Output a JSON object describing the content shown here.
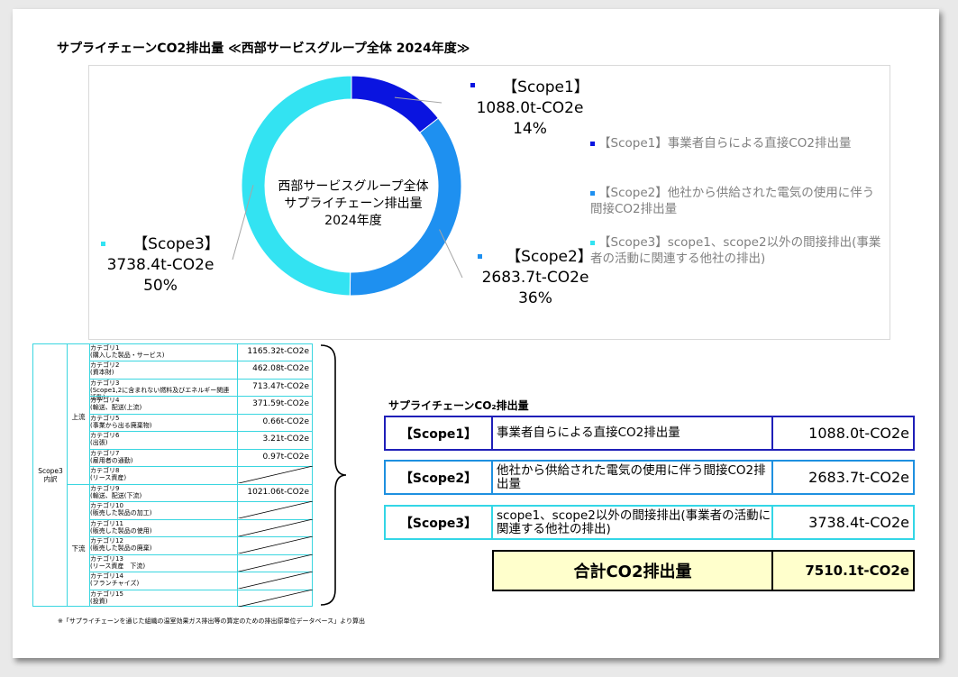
{
  "title": "サプライチェーンCO2排出量 ≪西部サービスグループ全体 2024年度≫",
  "chart_data": {
    "type": "pie",
    "donut": true,
    "center_label": [
      "西部サービスグループ全体",
      "サプライチェーン排出量",
      "2024年度"
    ],
    "slices": [
      {
        "label": "【Scope1】",
        "value": 1088.0,
        "value_text": "1088.0t-CO2e",
        "percent": "14%",
        "color": "#0a14e0"
      },
      {
        "label": "【Scope2】",
        "value": 2683.7,
        "value_text": "2683.7t-CO2e",
        "percent": "36%",
        "color": "#1e90f0"
      },
      {
        "label": "【Scope3】",
        "value": 3738.4,
        "value_text": "3738.4t-CO2e",
        "percent": "50%",
        "color": "#33e3f2"
      }
    ],
    "legend": [
      {
        "text": "【Scope1】事業者自らによる直接CO2排出量",
        "color": "#0a14e0"
      },
      {
        "text": "【Scope2】他社から供給された電気の使用に伴う間接CO2排出量",
        "color": "#1e90f0"
      },
      {
        "text": "【Scope3】scope1、scope2以外の間接排出(事業者の活動に関連する他社の排出)",
        "color": "#33e3f2"
      }
    ],
    "legend_position": "right"
  },
  "scope3_table": {
    "group_label": "Scope3\n内訳",
    "upstream_label": "上流",
    "downstream_label": "下流",
    "rows": [
      {
        "name": "カテゴリ1",
        "desc": "(購入した製品・サービス)",
        "value": "1165.32t-CO2e"
      },
      {
        "name": "カテゴリ2",
        "desc": "(資本財)",
        "value": "462.08t-CO2e"
      },
      {
        "name": "カテゴリ3",
        "desc": "(Scope1,2に含まれない燃料及びエネルギー関連活動)",
        "value": "713.47t-CO2e"
      },
      {
        "name": "カテゴリ4",
        "desc": "(輸送、配送(上流)",
        "value": "371.59t-CO2e"
      },
      {
        "name": "カテゴリ5",
        "desc": "(事業から出る廃棄物)",
        "value": "0.66t-CO2e"
      },
      {
        "name": "カテゴリ6",
        "desc": "(出張)",
        "value": "3.21t-CO2e"
      },
      {
        "name": "カテゴリ7",
        "desc": "(雇用者の通勤)",
        "value": "0.97t-CO2e"
      },
      {
        "name": "カテゴリ8",
        "desc": "(リース資産)",
        "value": ""
      },
      {
        "name": "カテゴリ9",
        "desc": "(輸送、配送(下流)",
        "value": "1021.06t-CO2e"
      },
      {
        "name": "カテゴリ10",
        "desc": "(販売した製品の加工)",
        "value": ""
      },
      {
        "name": "カテゴリ11",
        "desc": "(販売した製品の使用)",
        "value": ""
      },
      {
        "name": "カテゴリ12",
        "desc": "(販売した製品の廃棄)",
        "value": ""
      },
      {
        "name": "カテゴリ13",
        "desc": "(リース資産　下流)",
        "value": ""
      },
      {
        "name": "カテゴリ14",
        "desc": "(フランチャイズ)",
        "value": ""
      },
      {
        "name": "カテゴリ15",
        "desc": "(投資)",
        "value": ""
      }
    ],
    "footnote": "※「サプライチェーンを通じた組織の温室効果ガス排出等の算定のための排出原単位データベース」より算出"
  },
  "summary": {
    "title": "サプライチェーンCO₂排出量",
    "rows": [
      {
        "scope": "【Scope1】",
        "desc": "事業者自らによる直接CO2排出量",
        "value": "1088.0t-CO2e",
        "color": "#1f1fb8"
      },
      {
        "scope": "【Scope2】",
        "desc": "他社から供給された電気の使用に伴う間接CO2排出量",
        "value": "2683.7t-CO2e",
        "color": "#1e90e0"
      },
      {
        "scope": "【Scope3】",
        "desc": "scope1、scope2以外の間接排出(事業者の活動に関連する他社の排出)",
        "value": "3738.4t-CO2e",
        "color": "#33d6e6"
      }
    ],
    "total_label": "合計CO2排出量",
    "total_value": "7510.1t-CO2e"
  }
}
